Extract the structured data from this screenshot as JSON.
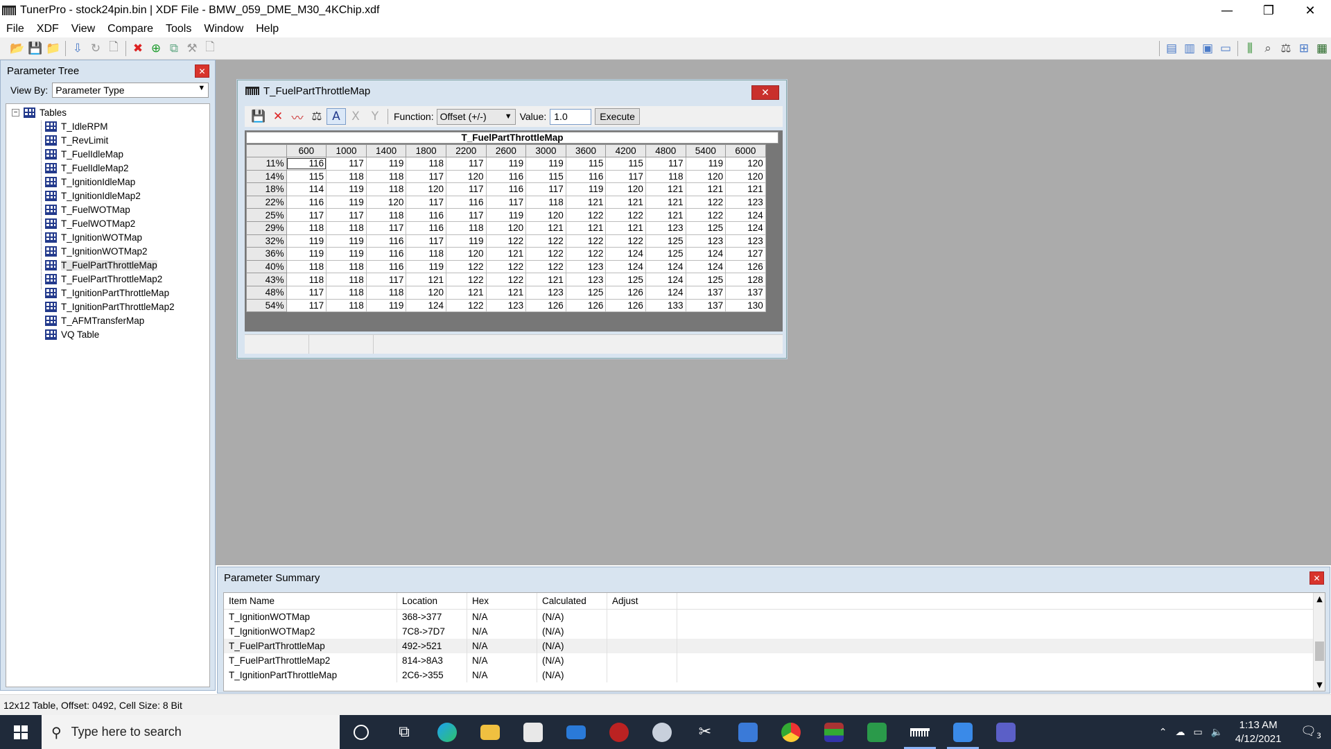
{
  "app": {
    "title": "TunerPro - stock24pin.bin | XDF File - BMW_059_DME_M30_4KChip.xdf"
  },
  "window_controls": {
    "minimize": "—",
    "restore": "❐",
    "close": "✕"
  },
  "menu": [
    "File",
    "XDF",
    "View",
    "Compare",
    "Tools",
    "Window",
    "Help"
  ],
  "param_tree": {
    "title": "Parameter Tree",
    "view_by_label": "View By:",
    "view_by_value": "Parameter Type",
    "root": "Tables",
    "items": [
      "T_IdleRPM",
      "T_RevLimit",
      "T_FuelIdleMap",
      "T_FuelIdleMap2",
      "T_IgnitionIdleMap",
      "T_IgnitionIdleMap2",
      "T_FuelWOTMap",
      "T_FuelWOTMap2",
      "T_IgnitionWOTMap",
      "T_IgnitionWOTMap2",
      "T_FuelPartThrottleMap",
      "T_FuelPartThrottleMap2",
      "T_IgnitionPartThrottleMap",
      "T_IgnitionPartThrottleMap2",
      "T_AFMTransferMap",
      "VQ Table"
    ]
  },
  "table_window": {
    "title": "T_FuelPartThrottleMap",
    "function_label": "Function:",
    "function_value": "Offset (+/-)",
    "value_label": "Value:",
    "value": "1.0",
    "execute_label": "Execute",
    "table_title": "T_FuelPartThrottleMap",
    "columns": [
      "600",
      "1000",
      "1400",
      "1800",
      "2200",
      "2600",
      "3000",
      "3600",
      "4200",
      "4800",
      "5400",
      "6000"
    ],
    "rows": [
      {
        "h": "11%",
        "v": [
          116,
          117,
          119,
          118,
          117,
          119,
          119,
          115,
          115,
          117,
          119,
          120
        ]
      },
      {
        "h": "14%",
        "v": [
          115,
          118,
          118,
          117,
          120,
          116,
          115,
          116,
          117,
          118,
          120,
          120
        ]
      },
      {
        "h": "18%",
        "v": [
          114,
          119,
          118,
          120,
          117,
          116,
          117,
          119,
          120,
          121,
          121,
          121
        ]
      },
      {
        "h": "22%",
        "v": [
          116,
          119,
          120,
          117,
          116,
          117,
          118,
          121,
          121,
          121,
          122,
          123
        ]
      },
      {
        "h": "25%",
        "v": [
          117,
          117,
          118,
          116,
          117,
          119,
          120,
          122,
          122,
          121,
          122,
          124
        ]
      },
      {
        "h": "29%",
        "v": [
          118,
          118,
          117,
          116,
          118,
          120,
          121,
          121,
          121,
          123,
          125,
          124
        ]
      },
      {
        "h": "32%",
        "v": [
          119,
          119,
          116,
          117,
          119,
          122,
          122,
          122,
          122,
          125,
          123,
          123
        ]
      },
      {
        "h": "36%",
        "v": [
          119,
          119,
          116,
          118,
          120,
          121,
          122,
          122,
          124,
          125,
          124,
          127
        ]
      },
      {
        "h": "40%",
        "v": [
          118,
          118,
          116,
          119,
          122,
          122,
          122,
          123,
          124,
          124,
          124,
          126
        ]
      },
      {
        "h": "43%",
        "v": [
          118,
          118,
          117,
          121,
          122,
          122,
          121,
          123,
          125,
          124,
          125,
          128
        ]
      },
      {
        "h": "48%",
        "v": [
          117,
          118,
          118,
          120,
          121,
          121,
          123,
          125,
          126,
          124,
          137,
          137
        ]
      },
      {
        "h": "54%",
        "v": [
          117,
          118,
          119,
          124,
          122,
          123,
          126,
          126,
          126,
          133,
          137,
          130
        ]
      }
    ]
  },
  "summary": {
    "title": "Parameter Summary",
    "headers": [
      "Item Name",
      "Location",
      "Hex",
      "Calculated",
      "Adjust"
    ],
    "rows": [
      [
        "T_IgnitionWOTMap",
        "368->377",
        "N/A",
        "(N/A)",
        ""
      ],
      [
        "T_IgnitionWOTMap2",
        "7C8->7D7",
        "N/A",
        "(N/A)",
        ""
      ],
      [
        "T_FuelPartThrottleMap",
        "492->521",
        "N/A",
        "(N/A)",
        ""
      ],
      [
        "T_FuelPartThrottleMap2",
        "814->8A3",
        "N/A",
        "(N/A)",
        ""
      ],
      [
        "T_IgnitionPartThrottleMap",
        "2C6->355",
        "N/A",
        "(N/A)",
        ""
      ]
    ]
  },
  "status": "12x12 Table, Offset: 0492,  Cell Size: 8 Bit",
  "taskbar": {
    "search_placeholder": "Type here to search",
    "time": "1:13 AM",
    "date": "4/12/2021",
    "notification_count": "3"
  },
  "colors": {
    "accent": "#233a8c",
    "panel": "#d8e4f0",
    "mdi": "#ababab",
    "close": "#c9302c"
  }
}
